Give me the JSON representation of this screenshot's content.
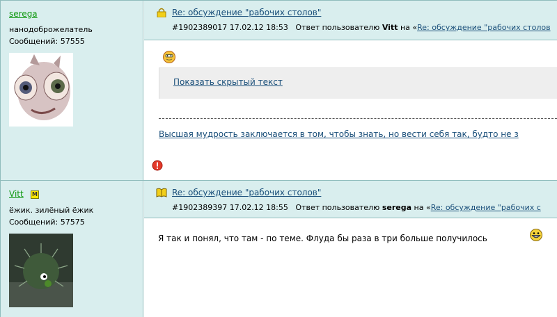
{
  "posts": [
    {
      "username": "serega",
      "user_title": "нанодоброжелатель",
      "user_posts": "Сообщений: 57555",
      "title": "Re: обсуждение \"рабочих столов\"",
      "meta_id_date": "#1902389017 17.02.12 18:53",
      "meta_reply_prefix": "Ответ пользователю",
      "meta_reply_user": "Vitt",
      "meta_on": "на «",
      "meta_reply_link": "Re: обсуждение \"рабочих столов",
      "spoiler_label": "Показать скрытый текст",
      "signature": "Высшая мудрость заключается в том, чтобы знать, но вести себя так, будто не з"
    },
    {
      "username": "Vitt",
      "badge": "M",
      "user_title": "ёжик. зилёный ёжик",
      "user_posts": "Сообщений: 57575",
      "title": "Re: обсуждение \"рабочих столов\"",
      "meta_id_date": "#1902389397 17.02.12 18:55",
      "meta_reply_prefix": "Ответ пользователю",
      "meta_reply_user": "serega",
      "meta_on": "на «",
      "meta_reply_link": "Re: обсуждение \"рабочих с",
      "message": "Я так и понял, что там - по теме. Флуда бы раза в три больше получилось"
    }
  ],
  "icons": {
    "post1_header": "lock-icon",
    "post2_header": "book-icon",
    "smile": "smiley-icon",
    "warn": "warning-icon",
    "grin": "grin-icon"
  },
  "colors": {
    "panel_bg": "#d9eeee",
    "border": "#8fbcbc",
    "link": "#1a4f7a",
    "username": "#119911"
  }
}
